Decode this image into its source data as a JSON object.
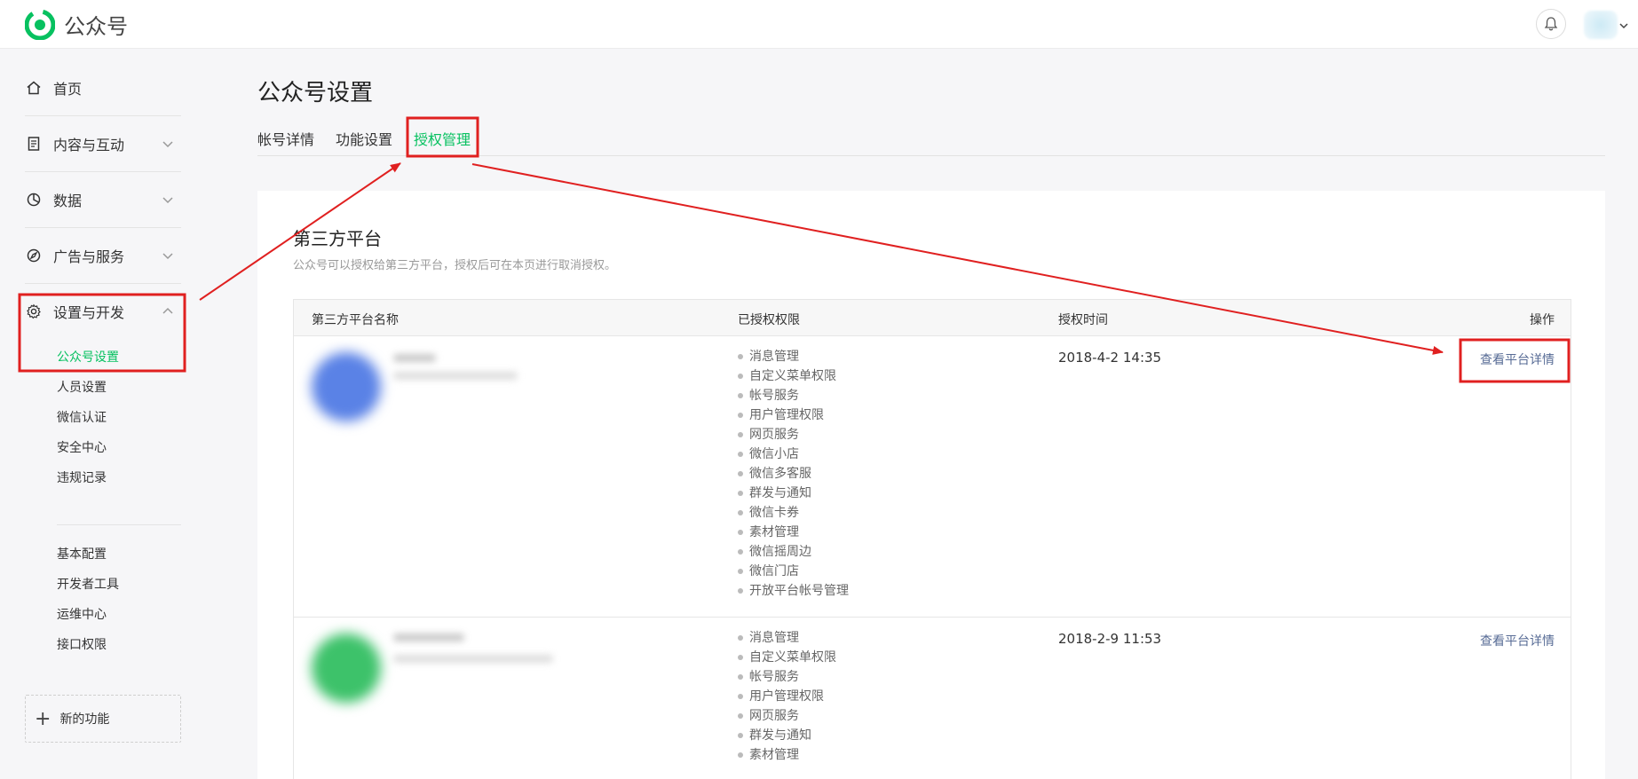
{
  "header": {
    "app_name": "公众号",
    "bell_icon": "bell-icon",
    "avatar": "avatar"
  },
  "sidebar": {
    "items": [
      {
        "label": "首页",
        "icon": "home-icon"
      },
      {
        "label": "内容与互动",
        "icon": "document-icon"
      },
      {
        "label": "数据",
        "icon": "pie-chart-icon"
      },
      {
        "label": "广告与服务",
        "icon": "compass-icon"
      },
      {
        "label": "设置与开发",
        "icon": "gear-icon"
      }
    ],
    "sub_items_a": [
      "公众号设置",
      "人员设置",
      "微信认证",
      "安全中心",
      "违规记录"
    ],
    "sub_items_b": [
      "基本配置",
      "开发者工具",
      "运维中心",
      "接口权限"
    ],
    "new_function": "新的功能"
  },
  "main": {
    "page_title": "公众号设置",
    "tabs": [
      {
        "label": "帐号详情"
      },
      {
        "label": "功能设置"
      },
      {
        "label": "授权管理",
        "active": true
      }
    ],
    "section": {
      "title": "第三方平台",
      "description": "公众号可以授权给第三方平台，授权后可在本页进行取消授权。"
    },
    "table": {
      "headers": [
        "第三方平台名称",
        "已授权权限",
        "授权时间",
        "操作"
      ],
      "rows": [
        {
          "permissions": [
            "消息管理",
            "自定义菜单权限",
            "帐号服务",
            "用户管理权限",
            "网页服务",
            "微信小店",
            "微信多客服",
            "群发与通知",
            "微信卡券",
            "素材管理",
            "微信摇周边",
            "微信门店",
            "开放平台帐号管理"
          ],
          "time": "2018-4-2 14:35",
          "action": "查看平台详情"
        },
        {
          "permissions": [
            "消息管理",
            "自定义菜单权限",
            "帐号服务",
            "用户管理权限",
            "网页服务",
            "群发与通知",
            "素材管理"
          ],
          "time": "2018-2-9 11:53",
          "action": "查看平台详情"
        }
      ]
    }
  },
  "colors": {
    "accent_green": "#07c160",
    "link_blue": "#576b95",
    "annotation_red": "#e02020"
  }
}
